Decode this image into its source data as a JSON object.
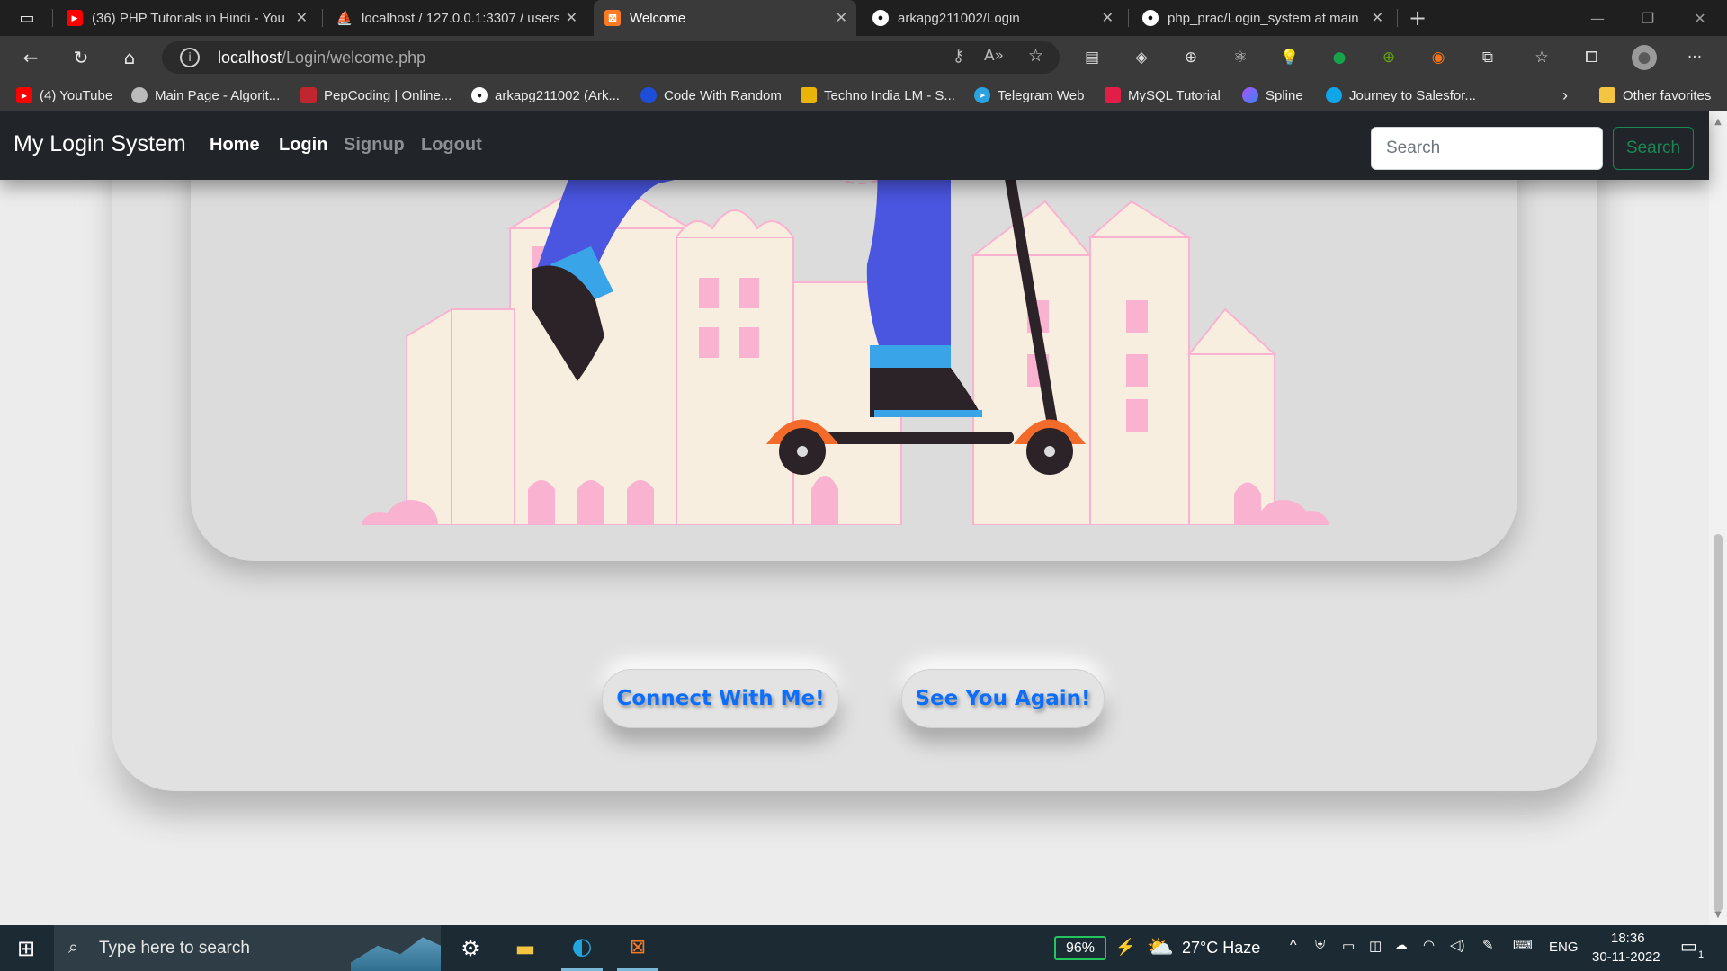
{
  "tabs": [
    {
      "title": "(36) PHP Tutorials in Hindi - You",
      "icon": "youtube-icon",
      "active": false
    },
    {
      "title": "localhost / 127.0.0.1:3307 / users",
      "icon": "phpmyadmin-icon",
      "active": false
    },
    {
      "title": "Welcome",
      "icon": "xampp-icon",
      "active": true
    },
    {
      "title": "arkapg211002/Login",
      "icon": "github-icon",
      "active": false
    },
    {
      "title": "php_prac/Login_system at main",
      "icon": "github-icon",
      "active": false
    }
  ],
  "address": {
    "host": "localhost",
    "path": "/Login/welcome.php"
  },
  "bookmarks": [
    {
      "label": "(4) YouTube",
      "icon": "youtube-icon"
    },
    {
      "label": "Main Page - Algorit...",
      "icon": "algorithms-icon"
    },
    {
      "label": "PepCoding | Online...",
      "icon": "pepcoding-icon"
    },
    {
      "label": "arkapg211002 (Ark...",
      "icon": "github-icon"
    },
    {
      "label": "Code With Random",
      "icon": "codewithrandom-icon"
    },
    {
      "label": "Techno India LM - S...",
      "icon": "techno-india-icon"
    },
    {
      "label": "Telegram Web",
      "icon": "telegram-icon"
    },
    {
      "label": "MySQL Tutorial",
      "icon": "mysql-icon"
    },
    {
      "label": "Spline",
      "icon": "spline-icon"
    },
    {
      "label": "Journey to Salesfor...",
      "icon": "salesforce-icon"
    }
  ],
  "other_favorites": "Other favorites",
  "navbar": {
    "brand": "My Login System",
    "links": [
      "Home",
      "Login",
      "Signup",
      "Logout"
    ],
    "search_placeholder": "Search",
    "search_button": "Search"
  },
  "buttons": {
    "connect": "Connect With Me!",
    "see_again": "See You Again!"
  },
  "taskbar": {
    "search_placeholder": "Type here to search",
    "battery": "96%",
    "weather": "27°C  Haze",
    "language": "ENG",
    "time": "18:36",
    "date": "30-11-2022",
    "notifications": "1"
  },
  "colors": {
    "navbar_bg": "#212529",
    "link_blue": "#0d6efd",
    "search_green": "#198754",
    "building_cream": "#f8eee0",
    "building_pink": "#f9b3d1",
    "pants_blue": "#4a55e0",
    "wheel_orange": "#f26b2a"
  }
}
